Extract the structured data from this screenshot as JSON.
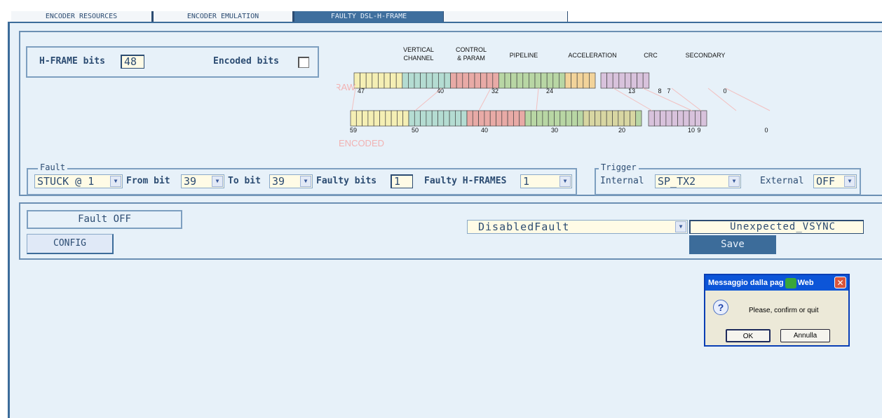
{
  "tabs": [
    {
      "label": "ENCODER RESOURCES",
      "active": false
    },
    {
      "label": "ENCODER EMULATION",
      "active": false
    },
    {
      "label": "FAULTY DSL-H-FRAME",
      "active": true
    }
  ],
  "hframe": {
    "bits_label": "H-FRAME bits",
    "bits_value": "48",
    "encoded_label": "Encoded bits",
    "encoded_checked": false
  },
  "diagram": {
    "raw_label": "RAW",
    "encoded_label": "ENCODED",
    "sections": [
      {
        "name": "VERTICAL CHANNEL",
        "line1": "VERTICAL",
        "line2": "CHANNEL",
        "color": "#f5efb4"
      },
      {
        "name": "CONTROL & PARAM",
        "line1": "CONTROL",
        "line2": "& PARAM",
        "color": "#b4dcd2"
      },
      {
        "name": "PIPELINE",
        "line1": "PIPELINE",
        "line2": "",
        "color": "#e8aaa6"
      },
      {
        "name": "ACCELERATION",
        "line1": "ACCELERATION",
        "line2": "",
        "color": "#b8d6a4"
      },
      {
        "name": "CRC",
        "line1": "CRC",
        "line2": "",
        "color": "#f2d39a"
      },
      {
        "name": "SECONDARY",
        "line1": "SECONDARY",
        "line2": "",
        "color": "#d8c2dc"
      }
    ],
    "raw_ticks": [
      "47",
      "40",
      "32",
      "24",
      "13",
      "8",
      "7",
      "0"
    ],
    "encoded_ticks": [
      "59",
      "50",
      "40",
      "30",
      "20",
      "10",
      "9",
      "0"
    ]
  },
  "fault": {
    "legend": "Fault",
    "type_value": "STUCK @ 1",
    "from_label": "From bit",
    "from_value": "39",
    "to_label": "To bit",
    "to_value": "39",
    "faulty_bits_label": "Faulty bits",
    "faulty_bits_value": "1",
    "faulty_hframes_label": "Faulty H-FRAMES",
    "faulty_hframes_value": "1"
  },
  "trigger": {
    "legend": "Trigger",
    "internal_label": "Internal",
    "internal_value": "SP_TX2",
    "external_label": "External",
    "external_value": "OFF"
  },
  "status": {
    "fault_status": "Fault OFF",
    "config_label": "CONFIG",
    "preset_value": "DisabledFault",
    "preset_name": "Unexpected_VSYNC",
    "save_label": "Save"
  },
  "dialog": {
    "title": "Messaggio dalla pag",
    "title_end": "Web",
    "message": "Please, confirm or quit",
    "ok_label": "OK",
    "cancel_label": "Annulla",
    "close_glyph": "✕",
    "question_glyph": "?"
  },
  "colors": {
    "panel_bg": "#e7f1f9",
    "accent": "#3c6c9a",
    "active_tab": "#3f6f9e",
    "field_bg": "#fffbe6",
    "dialog_title": "#0c55d8"
  }
}
